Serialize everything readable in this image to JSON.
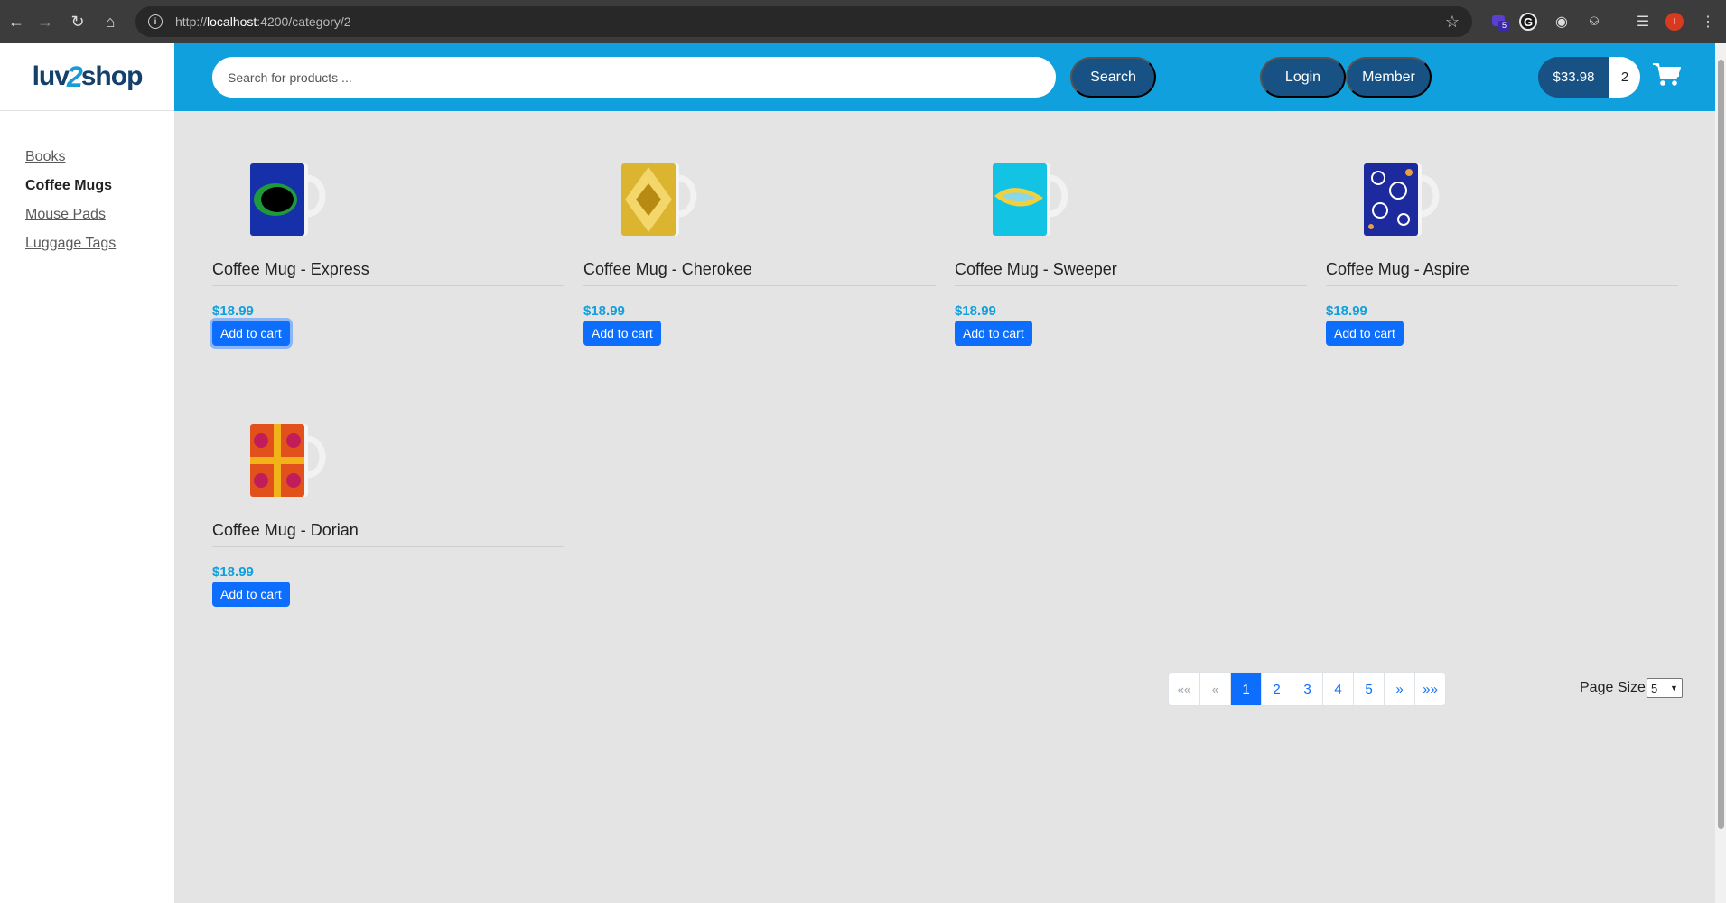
{
  "browser": {
    "url_prefix": "http://",
    "url_host": "localhost",
    "url_rest": ":4200/category/2",
    "extension_badge": "5",
    "profile_initial": "I"
  },
  "logo": {
    "part1": "luv",
    "part2": "2",
    "part3": "shop"
  },
  "categories": [
    {
      "label": "Books"
    },
    {
      "label": "Coffee Mugs"
    },
    {
      "label": "Mouse Pads"
    },
    {
      "label": "Luggage Tags"
    }
  ],
  "header": {
    "search_placeholder": "Search for products ...",
    "search_label": "Search",
    "login_label": "Login",
    "member_label": "Member",
    "cart_total": "$33.98",
    "cart_quantity": "2"
  },
  "products": [
    {
      "name": "Coffee Mug - Express",
      "price": "$18.99",
      "button": "Add to cart",
      "colors": [
        "#1530a8",
        "#1e9a3c",
        "#000000"
      ]
    },
    {
      "name": "Coffee Mug - Cherokee",
      "price": "$18.99",
      "button": "Add to cart",
      "colors": [
        "#dcb530",
        "#f3d76a",
        "#b88a12"
      ]
    },
    {
      "name": "Coffee Mug - Sweeper",
      "price": "$18.99",
      "button": "Add to cart",
      "colors": [
        "#12c3e4",
        "#f1d03c",
        "#8ad7e8"
      ]
    },
    {
      "name": "Coffee Mug - Aspire",
      "price": "$18.99",
      "button": "Add to cart",
      "colors": [
        "#1c2a9e",
        "#ffffff",
        "#e8a040"
      ]
    },
    {
      "name": "Coffee Mug - Dorian",
      "price": "$18.99",
      "button": "Add to cart",
      "colors": [
        "#e2501c",
        "#f2b21a",
        "#c21c5a"
      ]
    }
  ],
  "pagination": {
    "first": "««",
    "prev": "«",
    "pages": [
      "1",
      "2",
      "3",
      "4",
      "5"
    ],
    "active_page": "1",
    "next": "»",
    "last": "»»"
  },
  "page_size": {
    "label": "Page Size",
    "value": "5"
  }
}
